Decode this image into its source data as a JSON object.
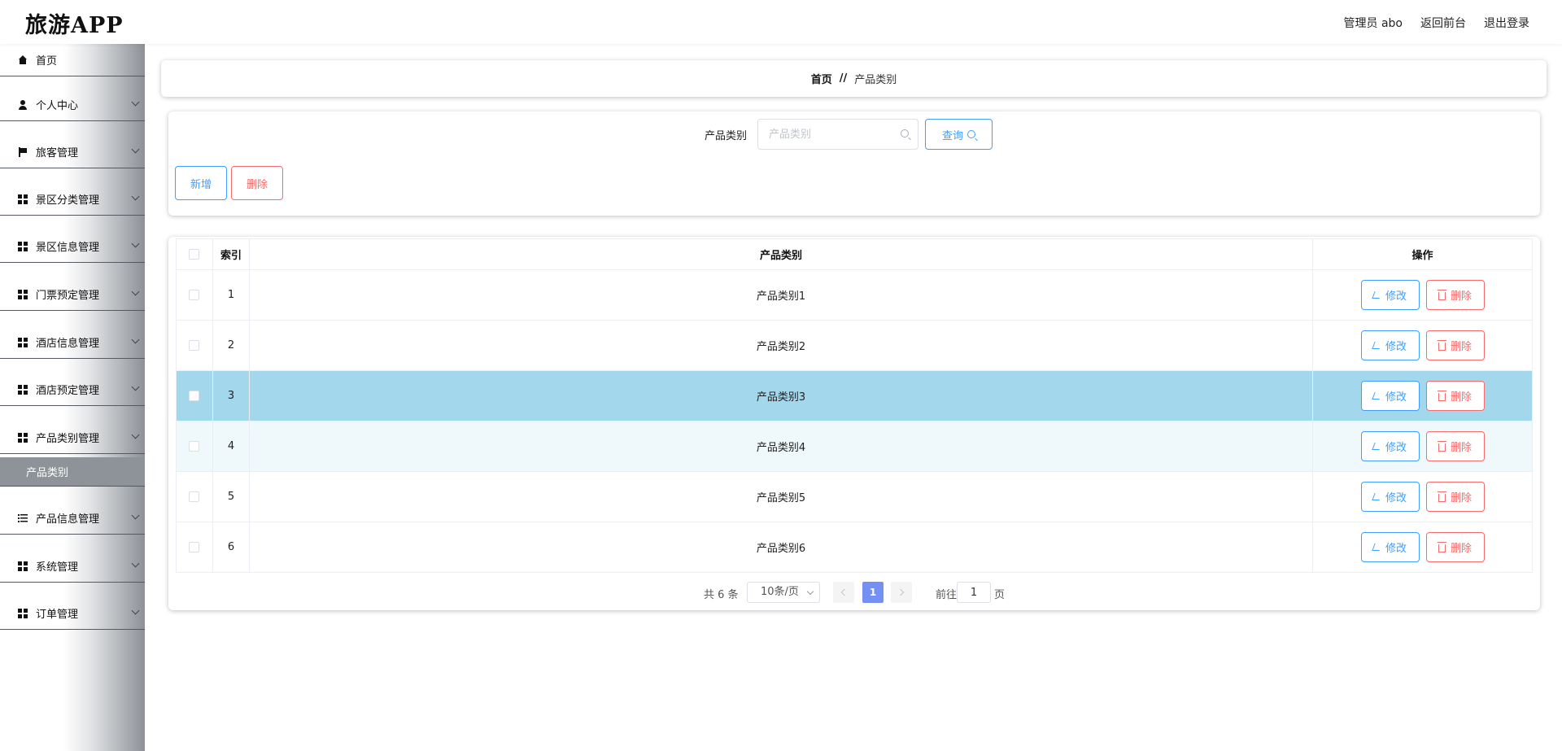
{
  "header": {
    "logo": "旅游APP",
    "admin": "管理员 abo",
    "back_to_front": "返回前台",
    "logout": "退出登录"
  },
  "sidebar": {
    "items": [
      {
        "label": "首页",
        "icon": "home-icon"
      },
      {
        "label": "个人中心",
        "icon": "user-icon"
      },
      {
        "label": "旅客管理",
        "icon": "flag-icon"
      },
      {
        "label": "景区分类管理",
        "icon": "grid-icon"
      },
      {
        "label": "景区信息管理",
        "icon": "grid-icon"
      },
      {
        "label": "门票预定管理",
        "icon": "grid-icon"
      },
      {
        "label": "酒店信息管理",
        "icon": "grid-icon"
      },
      {
        "label": "酒店预定管理",
        "icon": "grid-icon"
      },
      {
        "label": "产品类别管理",
        "icon": "grid-icon"
      },
      {
        "label": "产品信息管理",
        "icon": "list-icon"
      },
      {
        "label": "系统管理",
        "icon": "grid-icon"
      },
      {
        "label": "订单管理",
        "icon": "grid-icon"
      }
    ],
    "active_sub": "产品类别"
  },
  "breadcrumb": {
    "home": "首页",
    "separator": "//",
    "current": "产品类别"
  },
  "search": {
    "label": "产品类别",
    "placeholder": "产品类别",
    "value": "",
    "query_label": "查询",
    "add_label": "新增",
    "delete_label": "删除"
  },
  "table": {
    "headers": {
      "index": "索引",
      "category": "产品类别",
      "actions": "操作"
    },
    "edit_label": "修改",
    "delete_label": "删除",
    "rows": [
      {
        "index": "1",
        "category": "产品类别1"
      },
      {
        "index": "2",
        "category": "产品类别2"
      },
      {
        "index": "3",
        "category": "产品类别3"
      },
      {
        "index": "4",
        "category": "产品类别4"
      },
      {
        "index": "5",
        "category": "产品类别5"
      },
      {
        "index": "6",
        "category": "产品类别6"
      }
    ]
  },
  "pagination": {
    "total": "共 6 条",
    "page_size": "10条/页",
    "current_page": "1",
    "goto": "前往",
    "goto_value": "1",
    "unit": "页"
  },
  "colors": {
    "primary": "#409eff",
    "danger": "#f56c6c",
    "row_hover": "#a3d7ec",
    "row_striped": "#eff8fa",
    "active_page": "#7490f5"
  }
}
